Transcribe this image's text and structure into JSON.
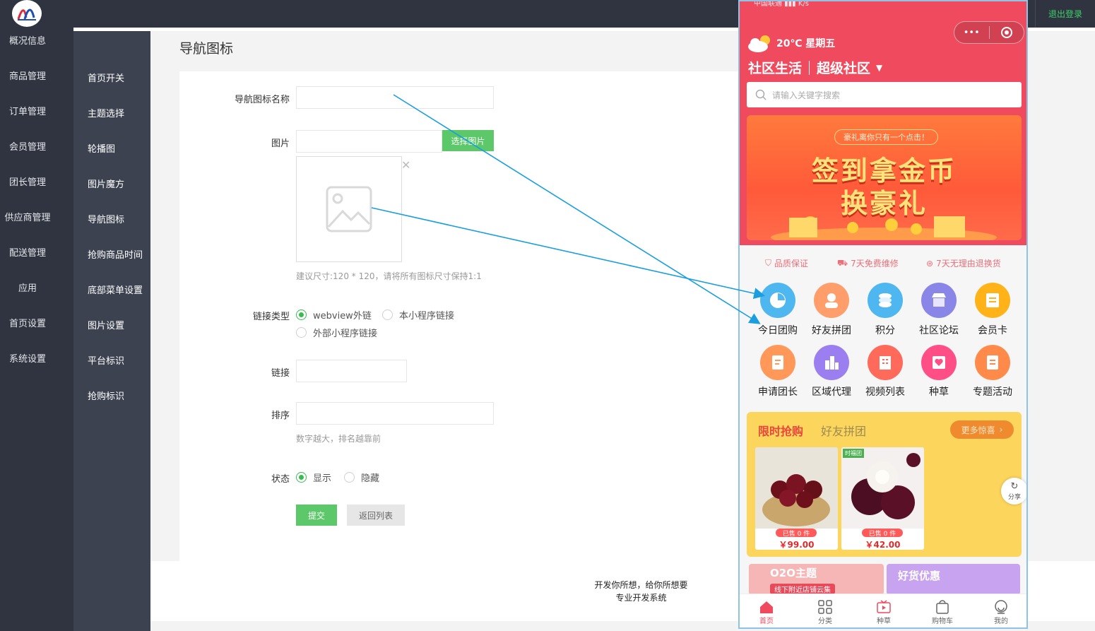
{
  "topbar": {
    "logout": "退出登录"
  },
  "sidebar_main": [
    "概况信息",
    "商品管理",
    "订单管理",
    "会员管理",
    "团长管理",
    "供应商管理",
    "配送管理",
    "应用",
    "首页设置",
    "系统设置"
  ],
  "sidebar_sub": [
    "首页开关",
    "主题选择",
    "轮播图",
    "图片魔方",
    "导航图标",
    "抢购商品时间",
    "底部菜单设置",
    "图片设置",
    "平台标识",
    "抢购标识"
  ],
  "page": {
    "title": "导航图标"
  },
  "form": {
    "name_label": "导航图标名称",
    "image_label": "图片",
    "choose_image": "选择图片",
    "image_hint": "建议尺寸:120 * 120，请将所有图标尺寸保持1:1",
    "link_type_label": "链接类型",
    "link_types": [
      "webview外链",
      "本小程序链接",
      "外部小程序链接"
    ],
    "link_label": "链接",
    "sort_label": "排序",
    "sort_hint": "数字越大，排名越靠前",
    "status_label": "状态",
    "status_options": [
      "显示",
      "隐藏"
    ],
    "submit": "提交",
    "back": "返回列表"
  },
  "footer": {
    "line1": "开发你所想，给你所想要",
    "line2": "专业开发系统"
  },
  "phone": {
    "statusbar": "中国联通  ▮▮▮  K/s",
    "weather": "20℃ 星期五",
    "community_left": "社区生活",
    "community_right": "超级社区",
    "search_placeholder": "请输入关键字搜索",
    "banner_pill": "豪礼离你只有一个点击！",
    "banner_line1": "签到拿金币",
    "banner_line2": "换豪礼",
    "guarantees": [
      "品质保证",
      "7天免费维修",
      "7天无理由退换货"
    ],
    "nav_row1": [
      "今日团购",
      "好友拼团",
      "积分",
      "社区论坛",
      "会员卡"
    ],
    "nav_row2": [
      "申请团长",
      "区域代理",
      "视频列表",
      "种草",
      "专题活动"
    ],
    "flash_title": "限时抢购",
    "flash_title2": "好友拼团",
    "flash_more": "更多惊喜",
    "products": [
      {
        "sold": "已售 0 件",
        "price": "￥99.00",
        "tag": ""
      },
      {
        "sold": "已售 0 件",
        "price": "￥42.00",
        "tag": "时福团"
      }
    ],
    "share": "分享",
    "card1_title": "O2O主题",
    "card1_sub": "线下附近店铺云集",
    "card2_title": "好货优惠",
    "tabs": [
      "首页",
      "分类",
      "种草",
      "购物车",
      "我的"
    ]
  }
}
